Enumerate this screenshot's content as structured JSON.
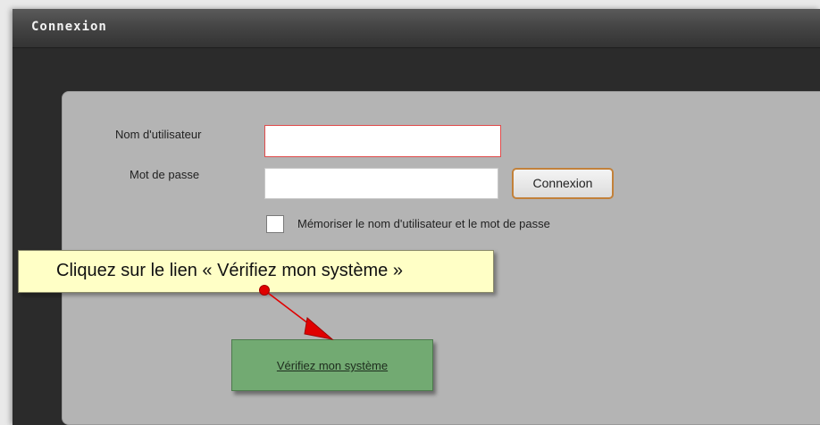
{
  "window": {
    "title": "Connexion"
  },
  "form": {
    "username_label": "Nom d'utilisateur",
    "username_value": "",
    "password_label": "Mot de passe",
    "password_value": "",
    "connect_label": "Connexion",
    "remember_label": "Mémoriser le nom d'utilisateur et le mot de passe",
    "remember_checked": false
  },
  "callout": {
    "text": "Cliquez sur le lien « Vérifiez mon système »"
  },
  "verify": {
    "label": "Vérifiez mon système"
  },
  "colors": {
    "window_bg": "#2b2b2b",
    "panel_bg": "#b4b4b4",
    "username_border": "#e04b4b",
    "connect_border": "#c2813a",
    "callout_bg": "#ffffc6",
    "verify_bg": "#72aa72",
    "arrow": "#e00000"
  }
}
